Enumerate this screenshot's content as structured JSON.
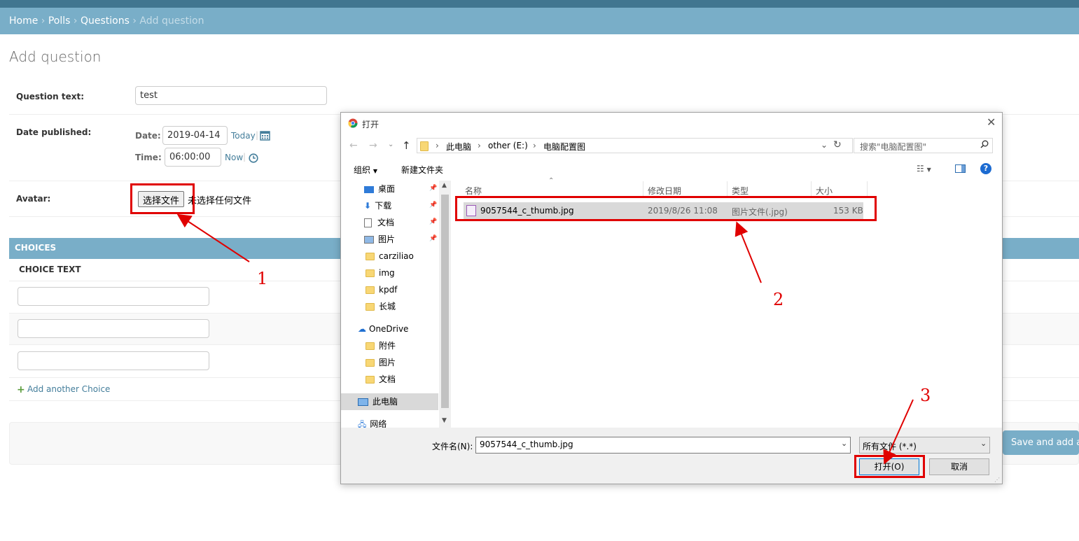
{
  "breadcrumbs": {
    "home": "Home",
    "polls": "Polls",
    "questions": "Questions",
    "current": "Add question",
    "sep": "›"
  },
  "page": {
    "title": "Add question"
  },
  "form": {
    "question_text_label": "Question text:",
    "question_text_value": "test",
    "date_published_label": "Date published:",
    "date_label": "Date:",
    "date_value": "2019-04-14",
    "today_link": "Today",
    "time_label": "Time:",
    "time_value": "06:00:00",
    "now_link": "Now",
    "pipe": "|",
    "avatar_label": "Avatar:",
    "choose_file_button": "选择文件",
    "no_file_text": "未选择任何文件"
  },
  "choices": {
    "section_title": "CHOICES",
    "column_header": "CHOICE TEXT",
    "add_another": "Add another Choice"
  },
  "submit": {
    "save_and_add": "Save and add another"
  },
  "dialog": {
    "title": "打开",
    "close": "✕",
    "address": {
      "pc": "此电脑",
      "drive": "other (E:)",
      "folder": "电脑配置图"
    },
    "search_placeholder": "搜索\"电脑配置图\"",
    "toolbar": {
      "organize": "组织",
      "new_folder": "新建文件夹"
    },
    "nav": {
      "quick": [
        "桌面",
        "下载",
        "文档",
        "图片",
        "carziliao",
        "img",
        "kpdf",
        "长城"
      ],
      "onedrive": "OneDrive",
      "onedrive_items": [
        "附件",
        "图片",
        "文档"
      ],
      "this_pc": "此电脑",
      "network": "网络"
    },
    "columns": {
      "name": "名称",
      "modified": "修改日期",
      "type": "类型",
      "size": "大小"
    },
    "file": {
      "name": "9057544_c_thumb.jpg",
      "modified": "2019/8/26 11:08",
      "type": "图片文件(.jpg)",
      "size": "153 KB"
    },
    "filename_label": "文件名(N):",
    "filename_value": "9057544_c_thumb.jpg",
    "filter_value": "所有文件 (*.*)",
    "open_button": "打开(O)",
    "cancel_button": "取消"
  },
  "annotations": {
    "step1": "1",
    "step2": "2",
    "step3": "3"
  },
  "colors": {
    "header": "#417690",
    "breadcrumbs": "#79aec8",
    "link": "#447e9b",
    "annotation": "#e00000",
    "selection": "#d9d9d9"
  }
}
